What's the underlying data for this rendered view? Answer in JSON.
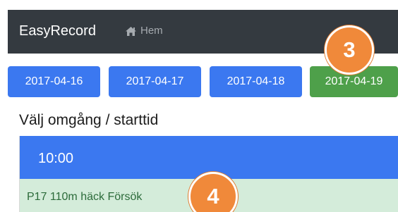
{
  "navbar": {
    "brand": "EasyRecord",
    "home_label": "Hem"
  },
  "dates": [
    {
      "label": "2017-04-16",
      "state": "default"
    },
    {
      "label": "2017-04-17",
      "state": "default"
    },
    {
      "label": "2017-04-18",
      "state": "default"
    },
    {
      "label": "2017-04-19",
      "state": "selected"
    }
  ],
  "heading": "Välj omgång / starttid",
  "session": {
    "time": "10:00",
    "events": [
      {
        "label": "P17 110m häck Försök"
      }
    ]
  },
  "annotations": [
    "3",
    "4"
  ],
  "icons": {
    "home": "home-icon"
  },
  "colors": {
    "navbar_bg": "#343a40",
    "primary": "#3b78f0",
    "success": "#4ea04a",
    "event_bg": "#d4ecda",
    "annotation": "#f0893a"
  }
}
